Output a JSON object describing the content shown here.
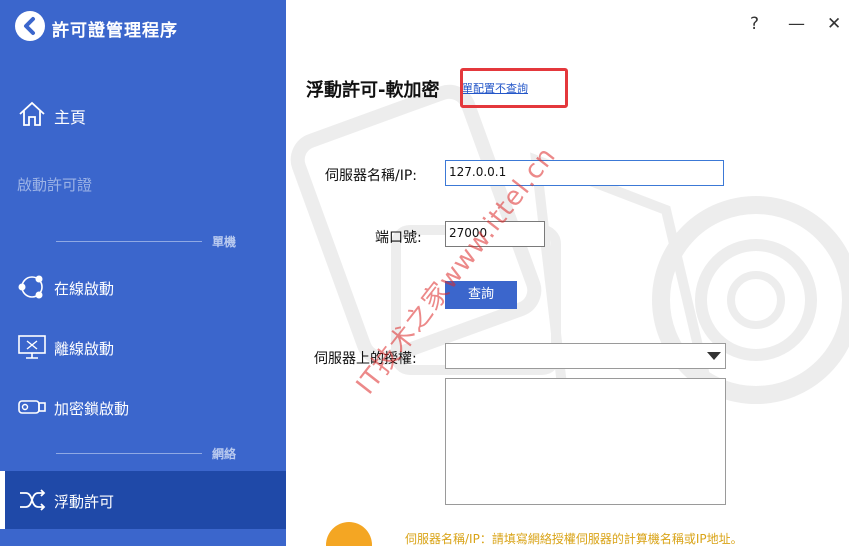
{
  "app": {
    "title": "許可證管理程序"
  },
  "sidebar": {
    "home": "主頁",
    "disabled_item": "啟動許可證",
    "section_standalone": "單機",
    "items": [
      {
        "label": "在線啟動",
        "icon": "share-nodes-icon"
      },
      {
        "label": "離線啟動",
        "icon": "monitor-icon"
      },
      {
        "label": "加密鎖啟動",
        "icon": "usb-key-icon"
      }
    ],
    "section_network": "網絡",
    "active_item": {
      "label": "浮動許可",
      "icon": "shuffle-icon"
    }
  },
  "window": {
    "help": "?",
    "minimize": "—",
    "close": "✕"
  },
  "main": {
    "title": "浮動許可-軟加密",
    "link": "單配置不查詢",
    "server_label": "伺服器名稱/IP:",
    "server_value": "127.0.0.1",
    "port_label": "端口號:",
    "port_value": "27000",
    "query_button": "查詢",
    "license_label": "伺服器上的授權:",
    "license_value": "",
    "hint": "伺服器名稱/IP：請填寫網絡授權伺服器的計算機名稱或IP地址。",
    "watermark": "IT技术之家www.ittel.cn"
  },
  "colors": {
    "sidebar": "#3b66cc",
    "active": "#1f49a8",
    "accent_red": "#e4383c",
    "hint": "#d9a316"
  }
}
